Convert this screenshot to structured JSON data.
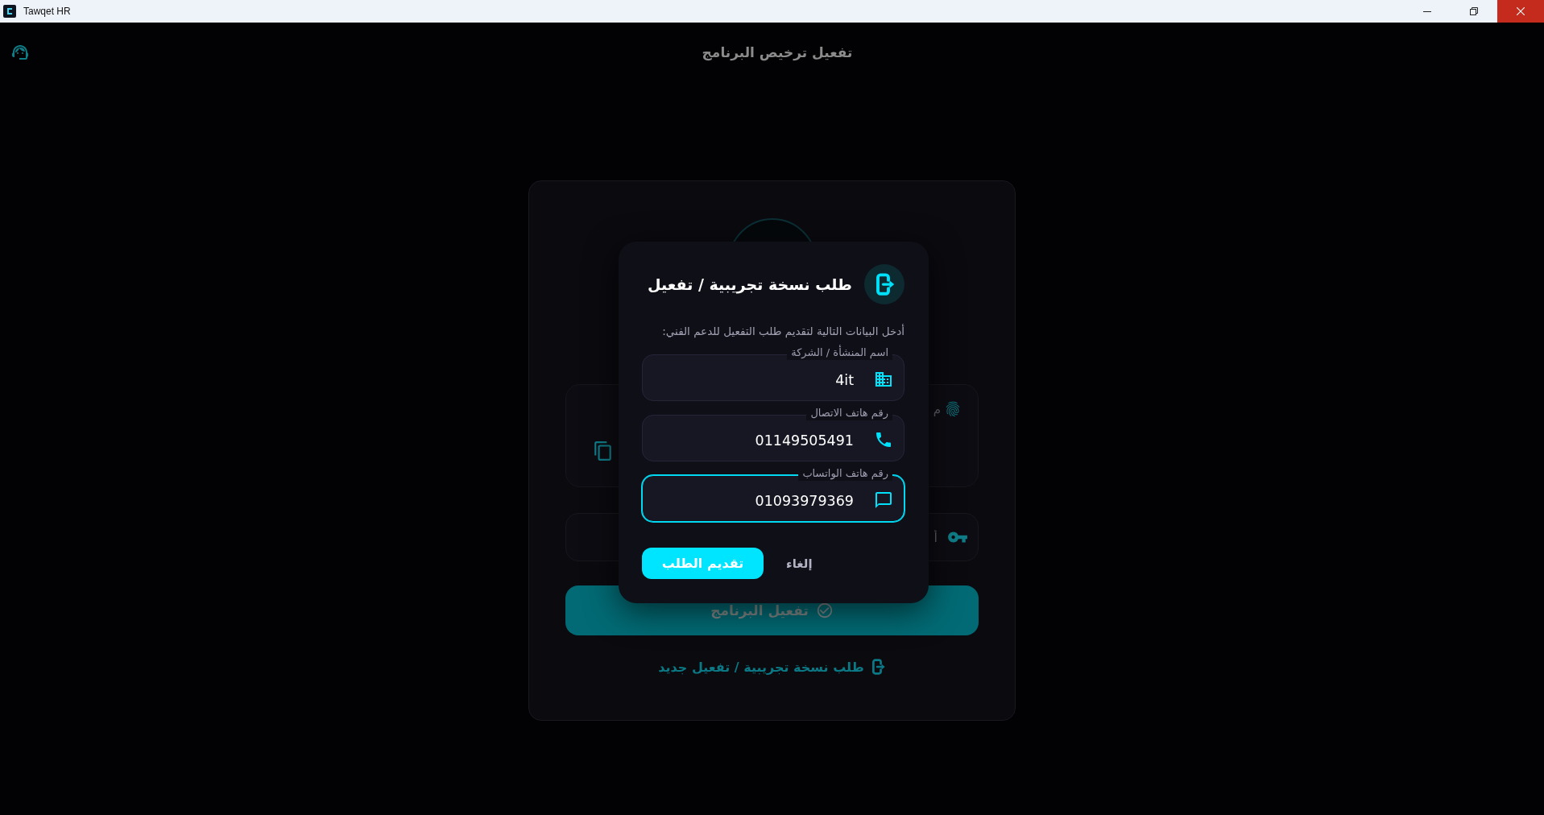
{
  "window": {
    "title": "Tawqet HR"
  },
  "header": {
    "title": "تفعيل ترخيص البرنامج"
  },
  "license_card": {
    "device_panel": {
      "text": "م"
    },
    "key_field": {
      "placeholder": "أ"
    },
    "activate_button": {
      "label": "تفعيل البرنامج",
      "disabled": true
    },
    "trial_link": {
      "label": "طلب نسخة تجريبية / تفعيل جديد"
    }
  },
  "dialog": {
    "title": "طلب نسخة تجريبية / تفعيل",
    "description": "أدخل البيانات التالية لتقديم طلب التفعيل للدعم الفني:",
    "fields": [
      {
        "kind": "company",
        "label": "اسم المنشأة / الشركة",
        "value": "4it",
        "focused": false
      },
      {
        "kind": "phone",
        "label": "رقم هاتف الاتصال",
        "value": "01149505491",
        "focused": false
      },
      {
        "kind": "whatsapp",
        "label": "رقم هاتف الواتساب",
        "value": "01093979369",
        "focused": true
      }
    ],
    "buttons": [
      {
        "kind": "text",
        "label": "إلغاء"
      },
      {
        "kind": "primary",
        "label": "تقديم الطلب"
      }
    ]
  }
}
